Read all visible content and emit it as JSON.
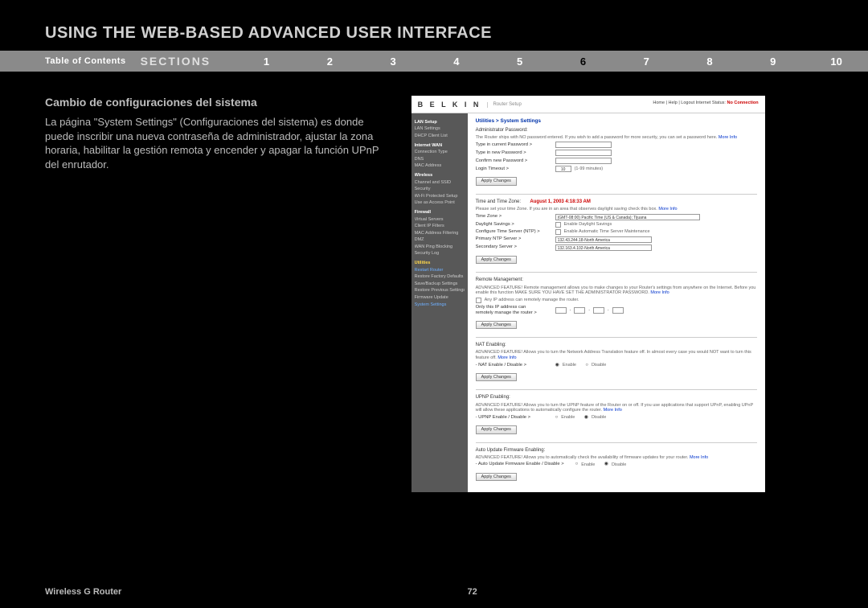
{
  "page_title": "USING THE WEB-BASED ADVANCED USER INTERFACE",
  "nav": {
    "toc": "Table of Contents",
    "sections": "SECTIONS",
    "items": [
      "1",
      "2",
      "3",
      "4",
      "5",
      "6",
      "7",
      "8",
      "9",
      "10"
    ],
    "active": "6"
  },
  "left": {
    "heading": "Cambio de configuraciones del sistema",
    "body": "La página \"System Settings\" (Configuraciones del sistema) es donde puede inscribir una nueva contraseña de administrador, ajustar la zona horaria, habilitar la gestión remota y encender y apagar la función UPnP del enrutador."
  },
  "footer": {
    "left": "Wireless G Router",
    "page": "72"
  },
  "router": {
    "brand": "B E L K I N",
    "subtitle": "Router Setup",
    "toplinks": "Home | Help | Logout   Internet Status:",
    "status": "No Connection",
    "sidebar": [
      {
        "t": "LAN Setup",
        "c": "sec-h"
      },
      {
        "t": "LAN Settings"
      },
      {
        "t": "DHCP Client List"
      },
      {
        "t": "Internet WAN",
        "c": "sec-h"
      },
      {
        "t": "Connection Type"
      },
      {
        "t": "DNS"
      },
      {
        "t": "MAC Address"
      },
      {
        "t": "Wireless",
        "c": "sec-h"
      },
      {
        "t": "Channel and SSID"
      },
      {
        "t": "Security"
      },
      {
        "t": "Wi-Fi Protected Setup"
      },
      {
        "t": "Use as Access Point"
      },
      {
        "t": "Firewall",
        "c": "sec-h"
      },
      {
        "t": "Virtual Servers"
      },
      {
        "t": "Client IP Filters"
      },
      {
        "t": "MAC Address Filtering"
      },
      {
        "t": "DMZ"
      },
      {
        "t": "WAN Ping Blocking"
      },
      {
        "t": "Security Log"
      },
      {
        "t": "Utilities",
        "c": "sec-h ylw"
      },
      {
        "t": "Restart Router",
        "c": "blu"
      },
      {
        "t": "Restore Factory Defaults"
      },
      {
        "t": "Save/Backup Settings"
      },
      {
        "t": "Restore Previous Settings"
      },
      {
        "t": "Firmware Update"
      },
      {
        "t": "System Settings",
        "c": "blu"
      }
    ],
    "crumb": "Utilities > System Settings",
    "admin": {
      "title": "Administrator Password:",
      "note": "The Router ships with NO password entered. If you wish to add a password for more security, you can set a password here. ",
      "more": "More Info",
      "r1": "Type in current Password >",
      "r2": "Type in new Password >",
      "r3": "Confirm new Password >",
      "r4": "Login Timeout >",
      "r4val": "10",
      "r4suffix": "(1-99 minutes)",
      "btn": "Apply Changes"
    },
    "time": {
      "title": "Time and Time Zone:",
      "stamp": "August 1, 2003  4:18:33 AM",
      "note": "Please set your time Zone. If you are in an area that observes daylight saving check this box. ",
      "more": "More Info",
      "r1": "Time Zone >",
      "r1val": "(GMT-08:00) Pacific Time (US & Canada); Tijuana",
      "r2": "Daylight Savings >",
      "r2chk": "Enable Daylight Savings",
      "r3": "Configure Time Server (NTP) >",
      "r3chk": "Enable Automatic Time Server Maintenance",
      "r4": "Primary NTP Server >",
      "r4val": "132.43.244.18-North America",
      "r5": "Secondary Server >",
      "r5val": "132.163.4.102-North America",
      "btn": "Apply Changes"
    },
    "remote": {
      "title": "Remote Management:",
      "note": "ADVANCED FEATURE! Remote management allows you to make changes to your Router's settings from anywhere on the Internet. Before you enable this function MAKE SURE YOU HAVE SET THE ADMINISTRATOR PASSWORD. ",
      "more": "More Info",
      "chk1": "Any IP address can remotely manage the router.",
      "line2a": "Only this IP address can",
      "line2b": "remotely   manage the router >",
      "btn": "Apply Changes"
    },
    "nat": {
      "title": "NAT Enabling:",
      "note": "ADVANCED FEATURE! Allows you to turn the Network Address Translation feature off. In almost every case you would NOT want to turn this feature off. ",
      "more": "More Info",
      "lbl": "- NAT Enable / Disable >",
      "opt1": "Enable",
      "opt2": "Disable",
      "btn": "Apply Changes"
    },
    "upnp": {
      "title": "UPNP Enabling:",
      "note": "ADVANCED FEATURE! Allows you to turn the UPNP feature of the Router on or off. If you use applications that support UPnP, enabling UPnP will allow these applications to automatically configure the router. ",
      "more": "More Info",
      "lbl": "- UPNP Enable / Disable >",
      "opt1": "Enable",
      "opt2": "Disable",
      "btn": "Apply Changes"
    },
    "fw": {
      "title": "Auto Update Firmware Enabling:",
      "note": "ADVANCED FEATURE! Allows you to automatically check the availability of firmware updates for your router. ",
      "more": "More Info",
      "lbl": "- Auto Update Firmware Enable / Disable >",
      "opt1": "Enable",
      "opt2": "Disable",
      "btn": "Apply Changes"
    }
  }
}
